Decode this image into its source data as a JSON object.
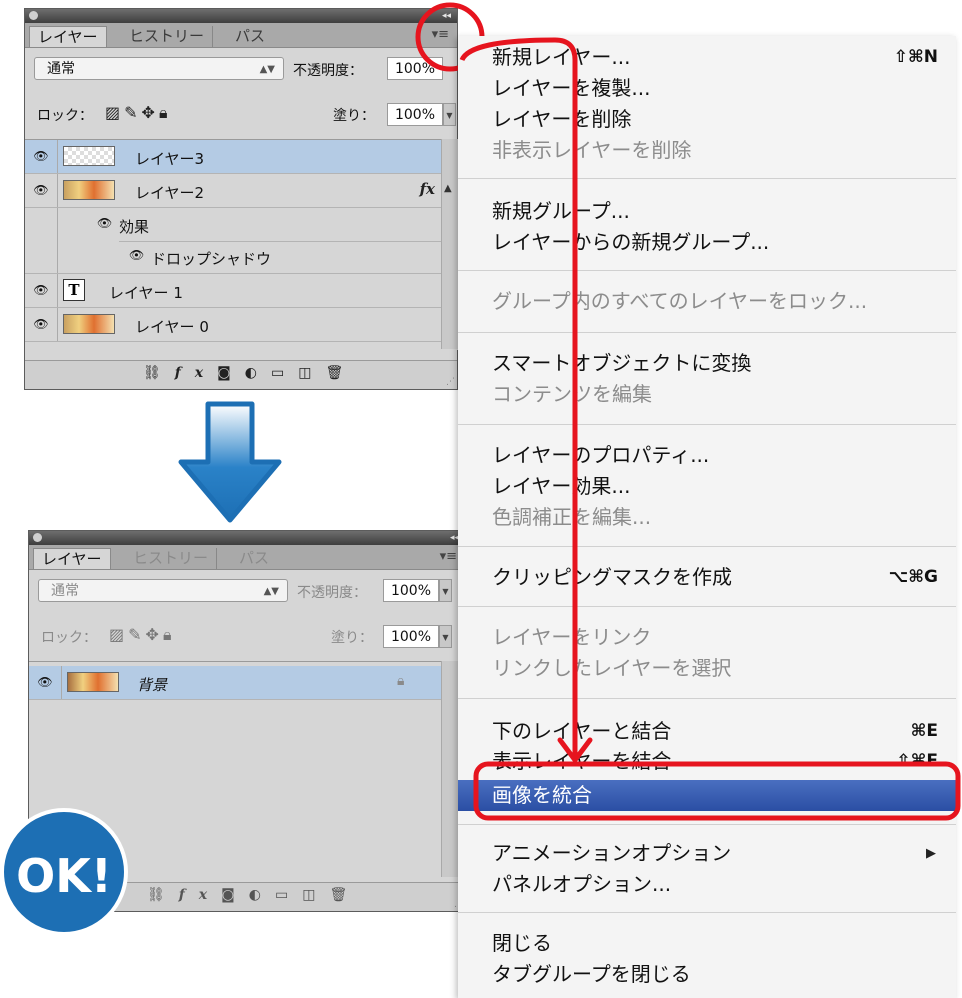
{
  "colors": {
    "accent_red": "#e6141e",
    "menu_highlight": "#3a5fb6",
    "arrow_blue": "#1d6fb4",
    "selected_row": "#b4cbe4"
  },
  "panel1": {
    "tabs": [
      "レイヤー",
      "ヒストリー",
      "パス"
    ],
    "blend_mode": "通常",
    "opacity_label": "不透明度：",
    "opacity_value": "100%",
    "lock_label": "ロック：",
    "fill_label": "塗り：",
    "fill_value": "100%",
    "layers": [
      {
        "name": "レイヤー3",
        "selected": true
      },
      {
        "name": "レイヤー2",
        "fx": "fx"
      },
      {
        "name": "効果"
      },
      {
        "name": "ドロップシャドウ"
      },
      {
        "name": "レイヤー 1",
        "type_icon": "T"
      },
      {
        "name": "レイヤー 0"
      }
    ]
  },
  "panel2": {
    "tabs": [
      "レイヤー",
      "ヒストリー",
      "パス"
    ],
    "blend_mode": "通常",
    "opacity_label": "不透明度：",
    "opacity_value": "100%",
    "lock_label": "ロック：",
    "fill_label": "塗り：",
    "fill_value": "100%",
    "layers": [
      {
        "name": "背景",
        "selected": true
      }
    ]
  },
  "ok_badge": "OK!",
  "menu": {
    "items": [
      {
        "label": "新規レイヤー...",
        "shortcut": "⇧⌘N"
      },
      {
        "label": "レイヤーを複製..."
      },
      {
        "label": "レイヤーを削除"
      },
      {
        "label": "非表示レイヤーを削除",
        "disabled": true
      },
      {
        "label": "新規グループ..."
      },
      {
        "label": "レイヤーからの新規グループ..."
      },
      {
        "label": "グループ内のすべてのレイヤーをロック...",
        "disabled": true
      },
      {
        "label": "スマートオブジェクトに変換"
      },
      {
        "label": "コンテンツを編集",
        "disabled": true
      },
      {
        "label": "レイヤーのプロパティ..."
      },
      {
        "label": "レイヤー効果..."
      },
      {
        "label": "色調補正を編集...",
        "disabled": true
      },
      {
        "label": "クリッピングマスクを作成",
        "shortcut": "⌥⌘G"
      },
      {
        "label": "レイヤーをリンク",
        "disabled": true
      },
      {
        "label": "リンクしたレイヤーを選択",
        "disabled": true
      },
      {
        "label": "下のレイヤーと結合",
        "shortcut": "⌘E"
      },
      {
        "label": "表示レイヤーを結合",
        "shortcut": "⇧⌘E"
      },
      {
        "label": "画像を統合",
        "highlighted": true
      },
      {
        "label": "アニメーションオプション",
        "submenu": "▶"
      },
      {
        "label": "パネルオプション..."
      },
      {
        "label": "閉じる"
      },
      {
        "label": "タブグループを閉じる"
      }
    ]
  }
}
